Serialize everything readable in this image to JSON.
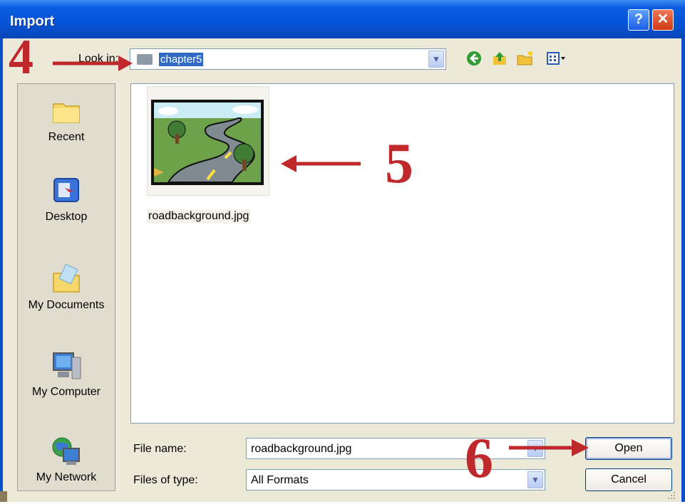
{
  "window": {
    "title": "Import",
    "help_label": "?",
    "close_label": "✕"
  },
  "lookin": {
    "label": "Look in:",
    "folder": "chapter5",
    "dropdown_icon": "chevron-down-icon"
  },
  "toolbar": {
    "back_icon": "back-icon",
    "up_icon": "up-folder-icon",
    "new_folder_icon": "new-folder-icon",
    "views_icon": "views-menu-icon"
  },
  "places": {
    "items": [
      {
        "label": "Recent",
        "icon": "recent-folder-icon"
      },
      {
        "label": "Desktop",
        "icon": "desktop-icon"
      },
      {
        "label": "My Documents",
        "icon": "my-documents-icon"
      },
      {
        "label": "My Computer",
        "icon": "my-computer-icon"
      },
      {
        "label": "My Network",
        "icon": "my-network-icon"
      }
    ]
  },
  "files": {
    "items": [
      {
        "name": "roadbackground.jpg"
      }
    ]
  },
  "filename": {
    "label": "File name:",
    "value": "roadbackground.jpg"
  },
  "filetype": {
    "label": "Files of type:",
    "value": "All Formats"
  },
  "buttons": {
    "open": "Open",
    "cancel": "Cancel"
  },
  "annotations": {
    "step4": "4",
    "step5": "5",
    "step6": "6",
    "color": "#c0292b"
  }
}
